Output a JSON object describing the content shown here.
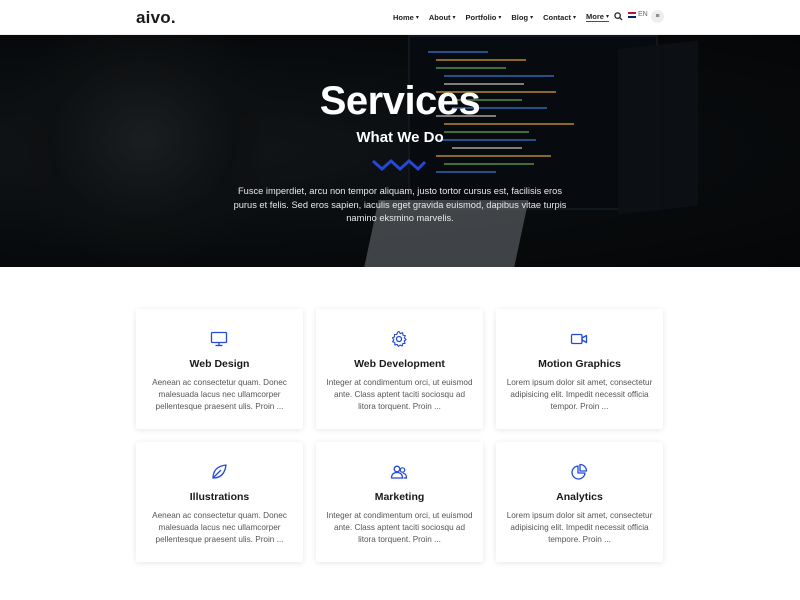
{
  "header": {
    "logo": "aivo.",
    "nav": [
      {
        "label": "Home"
      },
      {
        "label": "About"
      },
      {
        "label": "Portfolio"
      },
      {
        "label": "Blog"
      },
      {
        "label": "Contact"
      },
      {
        "label": "More"
      }
    ],
    "language": "EN",
    "search_icon": "search-icon",
    "menu_icon": "menu-icon"
  },
  "hero": {
    "title": "Services",
    "subtitle": "What We Do",
    "text": "Fusce imperdiet, arcu non tempor aliquam, justo tortor cursus est, facilisis eros purus et felis. Sed eros sapien, iaculis eget gravida euismod, dapibus vitae turpis namino eksmino marvelis."
  },
  "services": [
    {
      "title": "Web Design",
      "icon": "monitor-icon",
      "desc": "Aenean ac consectetur quam. Donec malesuada lacus nec ullamcorper pellentesque praesent ulis. Proin ..."
    },
    {
      "title": "Web Development",
      "icon": "gear-icon",
      "desc": "Integer at condimentum orci, ut euismod ante. Class aptent taciti sociosqu ad litora torquent. Proin ..."
    },
    {
      "title": "Motion Graphics",
      "icon": "video-camera-icon",
      "desc": "Lorem ipsum dolor sit amet, consectetur adipisicing elit. Impedit necessit officia tempor. Proin ..."
    },
    {
      "title": "Illustrations",
      "icon": "leaf-icon",
      "desc": "Aenean ac consectetur quam. Donec malesuada lacus nec ullamcorper pellentesque praesent ulis. Proin ..."
    },
    {
      "title": "Marketing",
      "icon": "users-icon",
      "desc": "Integer at condimentum orci, ut euismod ante. Class aptent taciti sociosqu ad litora torquent. Proin ..."
    },
    {
      "title": "Analytics",
      "icon": "pie-chart-icon",
      "desc": "Lorem ipsum dolor sit amet, consectetur adipisicing elit. Impedit necessit officia tempore. Proin ..."
    }
  ],
  "colors": {
    "accent": "#2448d8",
    "text": "#1a1a1a"
  }
}
